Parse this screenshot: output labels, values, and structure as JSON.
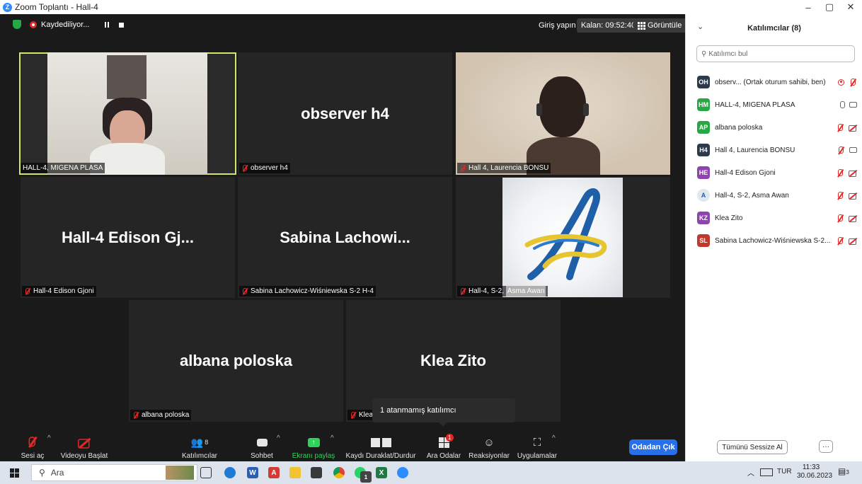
{
  "window": {
    "title": "Zoom Toplantı - Hall-4",
    "app_icon": "zoom-icon",
    "controls": [
      "minimize-icon",
      "maximize-icon",
      "close-icon"
    ]
  },
  "topbar": {
    "recording_label": "Kaydediliyor...",
    "sign_in": "Giriş yapın",
    "remaining": "Kalan: 09:52:40",
    "view": "Görüntüle"
  },
  "tiles": [
    {
      "id": "migena",
      "display_label": "HALL-4, MIGENA PLASA",
      "muted": false,
      "video": true,
      "active_speaker": true
    },
    {
      "id": "observer",
      "big_name": "observer h4",
      "display_label": "observer h4",
      "muted": true,
      "video": false
    },
    {
      "id": "laurencia",
      "display_label": "Hall 4, Laurencia BONSU",
      "muted": true,
      "video": true
    },
    {
      "id": "edison",
      "big_name": "Hall-4 Edison Gj...",
      "display_label": "Hall-4 Edison Gjoni",
      "muted": true,
      "video": false
    },
    {
      "id": "sabina",
      "big_name": "Sabina Lachowi...",
      "display_label": "Sabina Lachowicz-Wiśniewska S-2 H-4",
      "muted": true,
      "video": false
    },
    {
      "id": "asma",
      "display_label_prefix": "Hall-4, S-2,",
      "display_label_suffix": "Asma Awan",
      "muted": true,
      "video": false,
      "avatar_image": "letter-a-logo"
    },
    {
      "id": "albana",
      "big_name": "albana poloska",
      "display_label": "albana poloska",
      "muted": true,
      "video": false
    },
    {
      "id": "klea",
      "big_name": "Klea Zito",
      "display_label": "Klea",
      "muted": true,
      "video": false
    }
  ],
  "tooltip": "1 atanmamış katılımcı",
  "toolbar": {
    "unmute": "Sesi aç",
    "start_video": "Videoyu Başlat",
    "participants": "Katılımcılar",
    "participants_count": "8",
    "chat": "Sohbet",
    "share_screen": "Ekranı paylaş",
    "pause_record": "Kaydı Duraklat/Durdur",
    "breakout": "Ara Odalar",
    "breakout_badge": "1",
    "reactions": "Reaksiyonlar",
    "apps": "Uygulamalar",
    "leave": "Odadan Çık"
  },
  "panel": {
    "title": "Katılımcılar (8)",
    "search_placeholder": "Katılımcı bul",
    "mute_all": "Tümünü Sessize Al",
    "more": "···",
    "participants": [
      {
        "initials": "OH",
        "color": "#2d3a4a",
        "name": "observ...  (Ortak oturum sahibi, ben)",
        "recording": true,
        "mic": "off",
        "cam": "none"
      },
      {
        "initials": "HM",
        "color": "#27a844",
        "name": "HALL-4, MIGENA PLASA",
        "mic": "on",
        "cam": "on"
      },
      {
        "initials": "AP",
        "color": "#27a844",
        "name": "albana poloska",
        "mic": "off",
        "cam": "off"
      },
      {
        "initials": "H4",
        "color": "#2d3a4a",
        "name": "Hall 4, Laurencia BONSU",
        "mic": "off",
        "cam": "on"
      },
      {
        "initials": "HE",
        "color": "#8e44ad",
        "name": "Hall-4 Edison Gjoni",
        "mic": "off",
        "cam": "off"
      },
      {
        "initials": "A",
        "color": "#dfe7ef",
        "name": "Hall-4, S-2, Asma Awan",
        "mic": "off",
        "cam": "off",
        "image_avatar": true
      },
      {
        "initials": "KZ",
        "color": "#8e44ad",
        "name": "Klea Zito",
        "mic": "off",
        "cam": "off"
      },
      {
        "initials": "SL",
        "color": "#c0392b",
        "name": "Sabina Lachowicz-Wiśniewska S-2...",
        "mic": "off",
        "cam": "off"
      }
    ]
  },
  "taskbar": {
    "search": "Ara",
    "lang": "TUR",
    "time": "11:33",
    "date": "30.06.2023",
    "notifications": "3",
    "whatsapp_badge": "1"
  },
  "colors": {
    "accent": "#2d8cff",
    "muted_red": "#e02828",
    "active_border": "#d8e36b",
    "leave_blue": "#2870ea",
    "share_green": "#2fd35a"
  }
}
